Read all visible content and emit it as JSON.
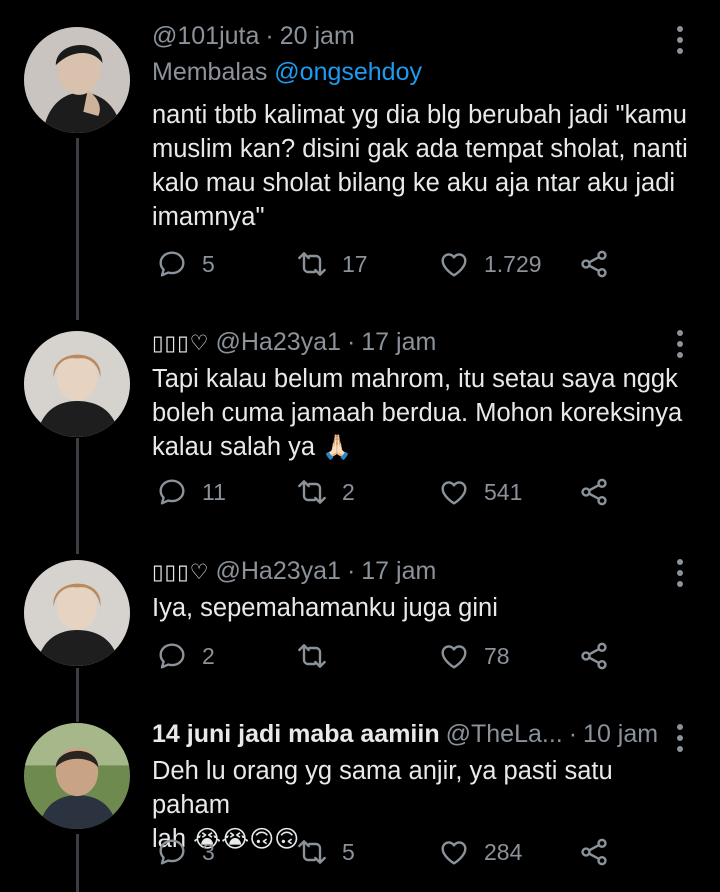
{
  "tweets": [
    {
      "handle": "@101juta",
      "time": "20 jam",
      "replying_prefix": "Membalas",
      "replying_to": "@ongsehdoy",
      "lines": [
        "nanti tbtb kalimat yg dia blg berubah jadi \"kamu",
        "muslim kan? disini gak ada tempat sholat, nanti",
        "kalo mau sholat bilang ke aku aja ntar aku jadi",
        "imamnya\""
      ],
      "replies": "5",
      "retweets": "17",
      "likes": "1.729"
    },
    {
      "display_name": "▯▯▯♡",
      "handle": "@Ha23ya1",
      "time": "17 jam",
      "lines": [
        "Tapi kalau belum mahrom, itu setau saya nggk",
        "boleh cuma jamaah berdua. Mohon koreksinya",
        "kalau salah ya"
      ],
      "emoji": "🙏🏻",
      "replies": "11",
      "retweets": "2",
      "likes": "541"
    },
    {
      "display_name": "▯▯▯♡",
      "handle": "@Ha23ya1",
      "time": "17 jam",
      "lines": [
        "Iya, sepemahamanku juga gini"
      ],
      "replies": "2",
      "retweets": "",
      "likes": "78"
    },
    {
      "display_name": "14 juni jadi maba aamiin",
      "handle": "@TheLa...",
      "time": "10 jam",
      "lines": [
        "Deh lu orang yg sama anjir, ya pasti satu paham",
        "lah"
      ],
      "emoji": "😭😭🙃🙃",
      "replies": "3",
      "retweets": "5",
      "likes": "284"
    }
  ],
  "colors": {
    "background": "#000000",
    "text": "#e7e9ea",
    "muted": "#8b9299",
    "mention": "#1d9bf0"
  },
  "icons": [
    "reply-icon",
    "retweet-icon",
    "like-icon",
    "share-icon",
    "more-options-icon"
  ]
}
